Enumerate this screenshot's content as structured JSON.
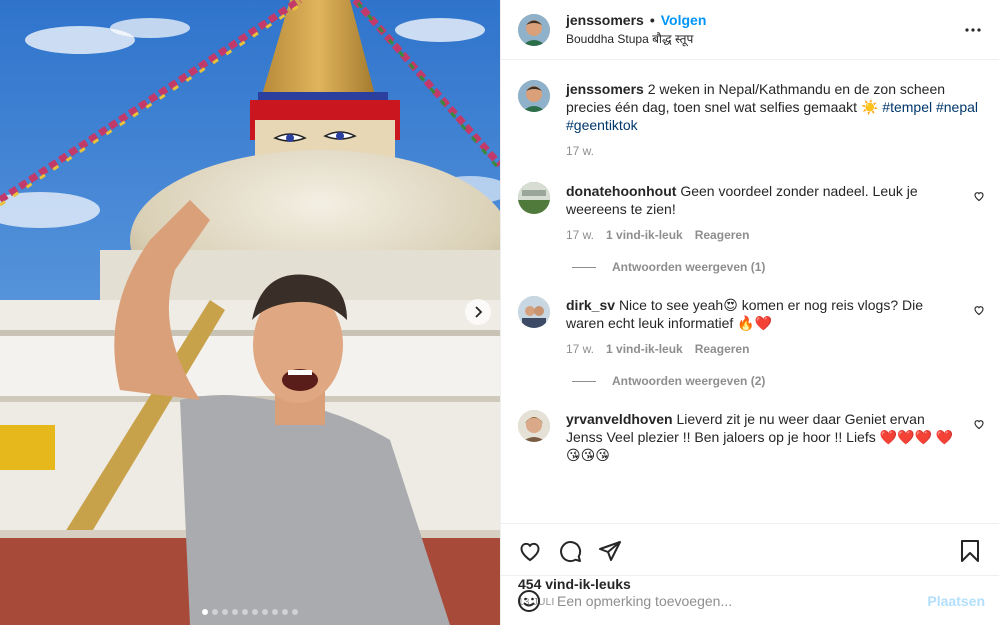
{
  "header": {
    "username": "jenssomers",
    "separator": "•",
    "follow_label": "Volgen",
    "location": "Bouddha Stupa बौद्ध स्तूप",
    "more_icon": "more-horizontal-icon"
  },
  "caption": {
    "username": "jenssomers",
    "text": "2 weken in Nepal/Kathmandu en de zon scheen precies één dag, toen snel wat selfies gemaakt ☀️",
    "hashtags": [
      "#tempel",
      "#nepal",
      "#geentiktok"
    ],
    "time": "17 w."
  },
  "comments": [
    {
      "username": "donatehoonhout",
      "text": "Geen voordeel zonder nadeel. Leuk je weereens te zien!",
      "time": "17 w.",
      "likes": "1 vind-ik-leuk",
      "reply_label": "Reageren",
      "replies_label": "Antwoorden weergeven (1)"
    },
    {
      "username": "dirk_sv",
      "text": "Nice to see yeah😍 komen er nog reis vlogs? Die waren echt leuk informatief 🔥❤️",
      "time": "17 w.",
      "likes": "1 vind-ik-leuk",
      "reply_label": "Reageren",
      "replies_label": "Antwoorden weergeven (2)"
    },
    {
      "username": "yrvanveldhoven",
      "text": "Lieverd zit je nu weer daar Geniet ervan Jenss Veel plezier !! Ben jaloers op je hoor !! Liefs ❤️❤️❤️ ❤️😘😘😘"
    }
  ],
  "stats": {
    "likes": "454 vind-ik-leuks",
    "date": "13 JULI"
  },
  "add_comment": {
    "placeholder": "Een opmerking toevoegen...",
    "post_label": "Plaatsen"
  },
  "carousel": {
    "slide_count": 10,
    "active_index": 0
  },
  "colors": {
    "link_blue": "#0095f6",
    "hashtag": "#00376b",
    "muted": "#8e8e8e",
    "post_disabled": "#b2dffc"
  }
}
